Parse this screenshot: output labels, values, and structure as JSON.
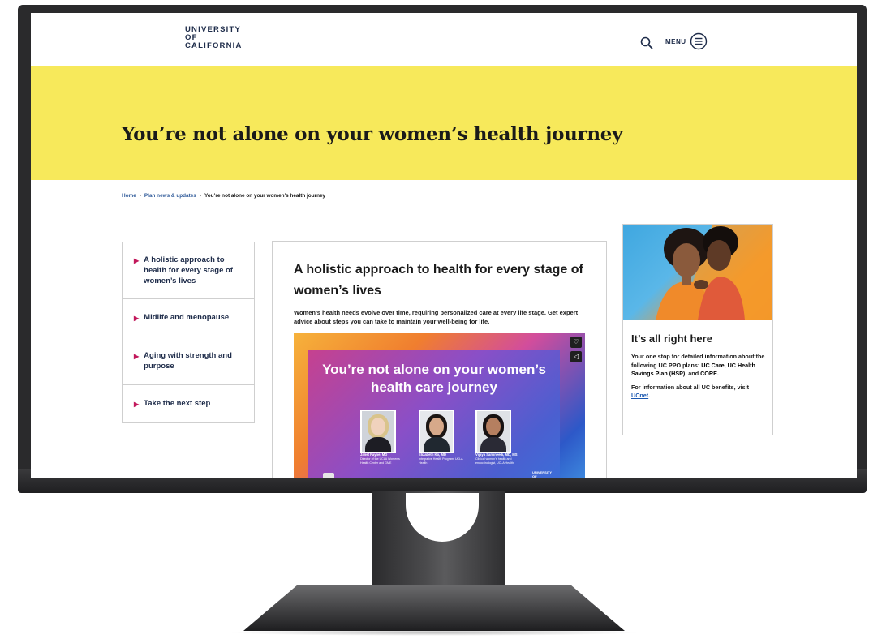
{
  "header": {
    "logo_lines": [
      "UNIVERSITY",
      "OF",
      "CALIFORNIA"
    ],
    "menu_label": "MENU"
  },
  "banner": {
    "title": "You’re not alone on your women’s health journey"
  },
  "breadcrumb": {
    "items": [
      "Home",
      "Plan news & updates",
      "You’re not alone on your women’s health journey"
    ],
    "separator": "›"
  },
  "side_nav": {
    "items": [
      {
        "label": "A holistic approach to health for every stage of women’s lives"
      },
      {
        "label": "Midlife and menopause"
      },
      {
        "label": "Aging with strength and purpose"
      },
      {
        "label": "Take the next step"
      }
    ],
    "arrow_color": "#c2185b"
  },
  "main": {
    "title": "A holistic approach to health for every stage of women’s lives",
    "description": "Women’s health needs evolve over time, requiring personalized care at every life stage. Get expert advice about steps you can take to maintain your well-being for life.",
    "video": {
      "title": "You’re not alone on your women’s health care journey",
      "people": [
        {
          "name": "Janet Payne, MD",
          "caption": "Director of the UCLA Women’s Health Center and GME"
        },
        {
          "name": "Elizabeth Ko, MD",
          "caption": "Integrative Health Program, UCLA Health"
        },
        {
          "name": "Vijaya Samineedi, MD, MS",
          "caption": "Clinical women’s health and endocrinologist, UCLA Health"
        }
      ],
      "brand": "UNIVERSITY OF CALIFORNIA"
    }
  },
  "info_card": {
    "title": "It’s all right here",
    "body_intro": "Your one stop for detailed information about the following UC PPO plans: ",
    "body_plans": "UC Care, UC Health Savings Plan (HSP)",
    "body_and": ", and ",
    "body_core": "CORE",
    "body_end": ".",
    "more_text": "For information about all UC benefits, visit ",
    "more_link": "UCnet",
    "more_end": "."
  },
  "colors": {
    "banner_bg": "#f7e95b",
    "navy": "#1d2b49",
    "accent": "#c2185b",
    "link": "#1a57b0"
  }
}
